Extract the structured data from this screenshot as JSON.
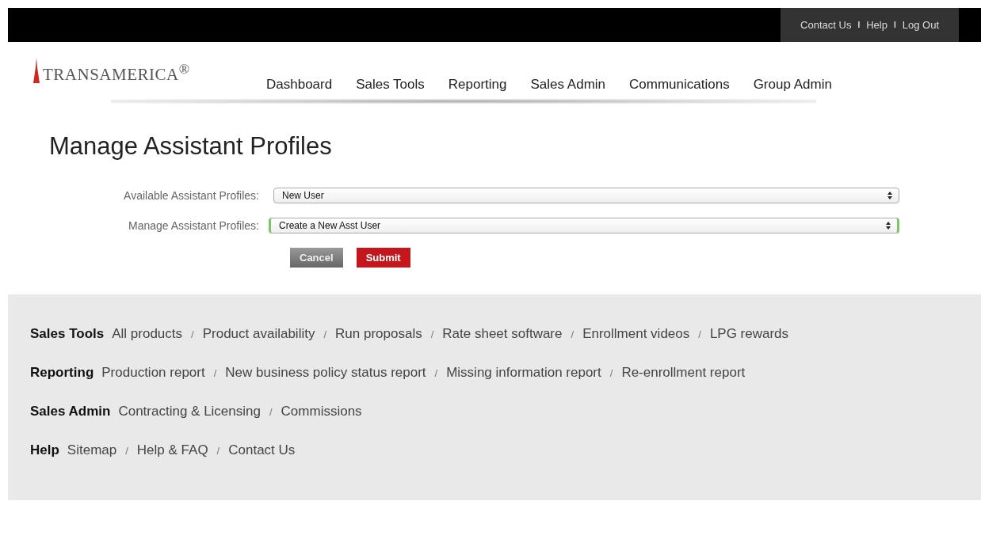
{
  "top_bar": {
    "items": [
      {
        "kind": "link",
        "text": "Contact Us"
      },
      {
        "kind": "separator",
        "text": "I"
      },
      {
        "kind": "link",
        "text": "Help"
      },
      {
        "kind": "separator",
        "text": "I"
      },
      {
        "kind": "link",
        "text": "Log Out"
      }
    ]
  },
  "logo": {
    "text": "TRANSAMERICA$^{®}$"
  },
  "nav": [
    {
      "label": "Dashboard"
    },
    {
      "label": "Sales Tools"
    },
    {
      "label": "Reporting"
    },
    {
      "label": "Sales Admin"
    },
    {
      "label": "Communications"
    },
    {
      "label": "Group Admin"
    }
  ],
  "page_title": "Manage Assistant Profiles",
  "form": {
    "fields": [
      {
        "label": "Available Assistant Profiles:",
        "value": "New User",
        "focused": false
      },
      {
        "label": "Manage Assistant Profiles:",
        "value": "Create a New Asst User",
        "focused": true
      }
    ],
    "buttons": [
      {
        "kind": "secondary",
        "label": "Cancel"
      },
      {
        "kind": "primary",
        "label": "Submit"
      }
    ]
  },
  "footer": {
    "sections": [
      {
        "title": "Sales Tools",
        "items": [
          {
            "kind": "link",
            "text": "All products"
          },
          {
            "kind": "separator",
            "text": "/"
          },
          {
            "kind": "link",
            "text": "Product availability"
          },
          {
            "kind": "separator",
            "text": "/"
          },
          {
            "kind": "link",
            "text": "Run proposals"
          },
          {
            "kind": "separator",
            "text": "/"
          },
          {
            "kind": "link",
            "text": "Rate sheet software"
          },
          {
            "kind": "separator",
            "text": "/"
          },
          {
            "kind": "link",
            "text": "Enrollment videos"
          },
          {
            "kind": "separator",
            "text": "/"
          },
          {
            "kind": "link",
            "text": "LPG rewards"
          }
        ]
      },
      {
        "title": "Reporting",
        "items": [
          {
            "kind": "link",
            "text": "Production report"
          },
          {
            "kind": "separator",
            "text": "/"
          },
          {
            "kind": "link",
            "text": "New business policy status report"
          },
          {
            "kind": "separator",
            "text": "/"
          },
          {
            "kind": "link",
            "text": "Missing information report"
          },
          {
            "kind": "separator",
            "text": "/"
          },
          {
            "kind": "link",
            "text": "Re-enrollment report"
          }
        ]
      },
      {
        "title": "Sales Admin",
        "items": [
          {
            "kind": "link",
            "text": "Contracting & Licensing"
          },
          {
            "kind": "separator",
            "text": "/"
          },
          {
            "kind": "link",
            "text": "Commissions"
          }
        ]
      },
      {
        "title": "Help",
        "items": [
          {
            "kind": "link",
            "text": "Sitemap"
          },
          {
            "kind": "separator",
            "text": "/"
          },
          {
            "kind": "link",
            "text": "Help & FAQ"
          },
          {
            "kind": "separator",
            "text": "/"
          },
          {
            "kind": "link",
            "text": "Contact Us"
          }
        ]
      }
    ]
  }
}
